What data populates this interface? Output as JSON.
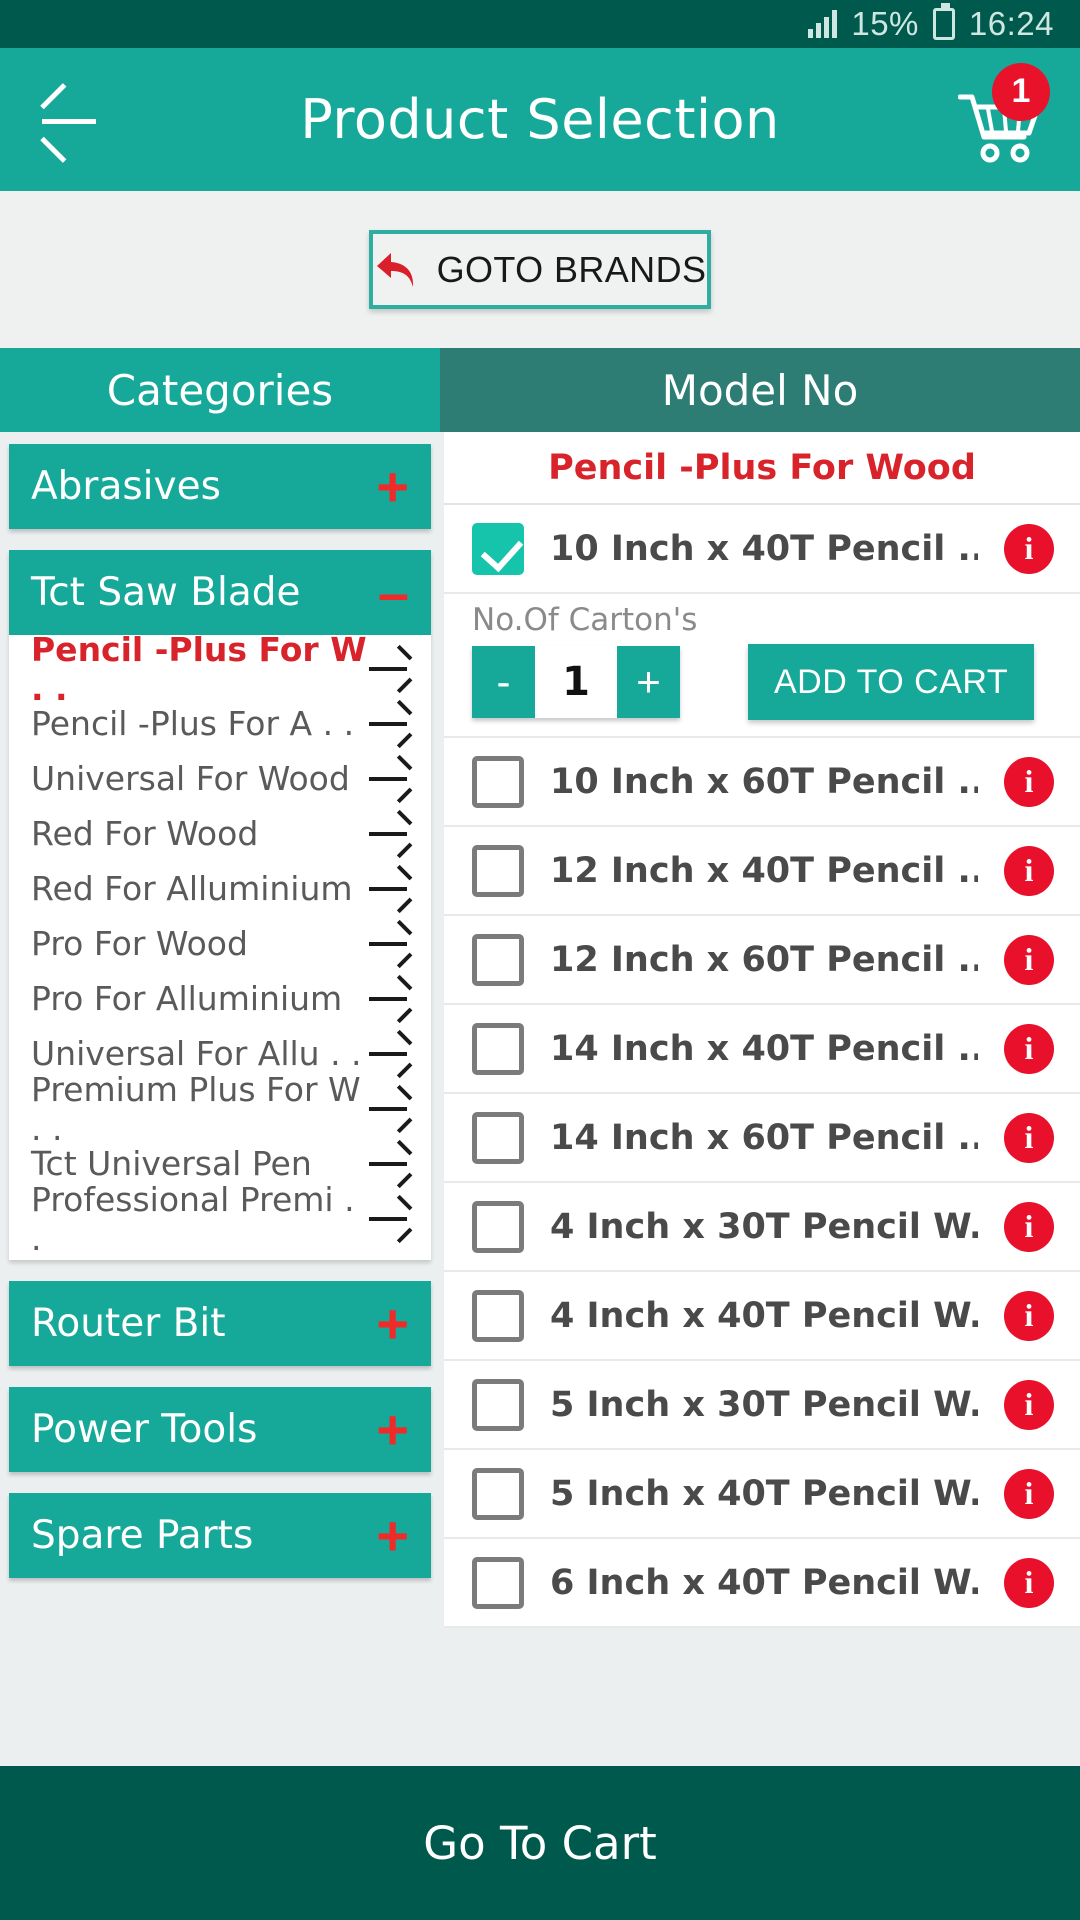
{
  "status_bar": {
    "battery_percent": "15%",
    "battery_icon": "battery-charging-icon",
    "signal_icon": "signal-bars-icon",
    "time": "16:24"
  },
  "app_bar": {
    "back_icon": "back-arrow-icon",
    "title": "Product Selection",
    "cart_icon": "shopping-cart-icon",
    "cart_badge": "1"
  },
  "brand_button": {
    "label": "GOTO BRANDS",
    "icon": "undo-arrow-icon"
  },
  "tabs": [
    {
      "label": "Categories",
      "active": true
    },
    {
      "label": "Model No",
      "active": false
    }
  ],
  "categories": [
    {
      "label": "Abrasives",
      "sign": "+",
      "expanded": false
    },
    {
      "label": "Tct Saw Blade",
      "sign": "–",
      "expanded": true
    },
    {
      "label": "Router Bit",
      "sign": "+",
      "expanded": false
    },
    {
      "label": "Power Tools",
      "sign": "+",
      "expanded": false
    },
    {
      "label": "Spare Parts",
      "sign": "+",
      "expanded": false
    }
  ],
  "subcategories": [
    {
      "label": "Pencil -Plus For W . .",
      "active": true
    },
    {
      "label": "Pencil -Plus For A . .",
      "active": false
    },
    {
      "label": "Universal For Wood",
      "active": false
    },
    {
      "label": "Red For Wood",
      "active": false
    },
    {
      "label": "Red For Alluminium",
      "active": false
    },
    {
      "label": "Pro For Wood",
      "active": false
    },
    {
      "label": "Pro For Alluminium",
      "active": false
    },
    {
      "label": "Universal For Allu . .",
      "active": false
    },
    {
      "label": "Premium Plus For W . .",
      "active": false
    },
    {
      "label": "Tct Universal Pen",
      "active": false
    },
    {
      "label": "Professional Premi . .",
      "active": false
    }
  ],
  "product_panel": {
    "title": "Pencil -Plus For Wood",
    "quantity_label": "No.Of Carton's",
    "quantity_value": "1",
    "decrement_label": "-",
    "increment_label": "+",
    "add_to_cart_label": "ADD TO CART",
    "info_icon_label": "i"
  },
  "products": [
    {
      "name": "10 Inch x 40T Pencil ...",
      "checked": true
    },
    {
      "name": "10 Inch x 60T Pencil ...",
      "checked": false
    },
    {
      "name": "12 Inch x 40T Pencil ...",
      "checked": false
    },
    {
      "name": "12 Inch x 60T Pencil ...",
      "checked": false
    },
    {
      "name": "14 Inch x 40T Pencil ...",
      "checked": false
    },
    {
      "name": "14 Inch x 60T Pencil ...",
      "checked": false
    },
    {
      "name": "4 Inch x 30T Pencil W...",
      "checked": false
    },
    {
      "name": "4 Inch x 40T Pencil W...",
      "checked": false
    },
    {
      "name": "5 Inch x 30T Pencil W...",
      "checked": false
    },
    {
      "name": "5 Inch x 40T Pencil W...",
      "checked": false
    },
    {
      "name": "6 Inch x 40T Pencil W...",
      "checked": false
    }
  ],
  "bottom_bar": {
    "label": "Go To Cart"
  },
  "colors": {
    "status_bar": "#00594d",
    "app_bar": "#16a99a",
    "tab_active": "#16a99a",
    "tab_inactive": "#2d7d74",
    "accent_red": "#e8102a",
    "title_red": "#d8232a",
    "bottom_bar": "#00594d"
  }
}
